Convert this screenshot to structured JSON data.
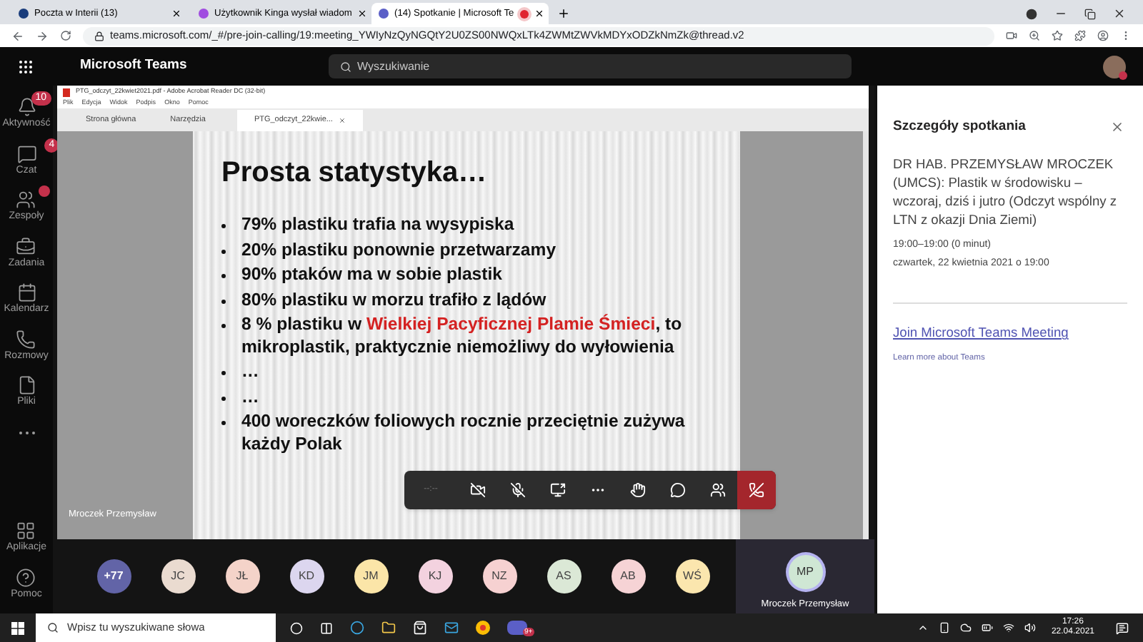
{
  "browser": {
    "tabs": [
      {
        "title": "Poczta w Interii (13)",
        "selected": false,
        "recording": false
      },
      {
        "title": "Użytkownik Kinga wysłał wiadom",
        "selected": false,
        "recording": false
      },
      {
        "title": "(14) Spotkanie | Microsoft Te",
        "selected": true,
        "recording": true
      }
    ],
    "url": "teams.microsoft.com/_#/pre-join-calling/19:meeting_YWIyNzQyNGQtY2U0ZS00NWQxLTk4ZWMtZWVkMDYxODZkNmZk@thread.v2"
  },
  "app": {
    "title": "Microsoft Teams",
    "search": {
      "placeholder": "Wyszukiwanie"
    }
  },
  "rail": [
    {
      "kind": "activity",
      "label": "Aktywność",
      "badge": "10",
      "dot": false
    },
    {
      "kind": "chat",
      "label": "Czat",
      "badge": "4",
      "dot": false
    },
    {
      "kind": "teams",
      "label": "Zespoły",
      "dot": true
    },
    {
      "kind": "tasks",
      "label": "Zadania",
      "dot": false
    },
    {
      "kind": "calendar",
      "label": "Kalendarz",
      "dot": false
    },
    {
      "kind": "calls",
      "label": "Rozmowy",
      "dot": false
    },
    {
      "kind": "files",
      "label": "Pliki",
      "dot": false
    },
    {
      "kind": "more",
      "dot": false
    },
    {
      "kind": "apps",
      "label": "Aplikacje",
      "dot": false
    },
    {
      "kind": "help",
      "label": "Pomoc",
      "dot": false
    }
  ],
  "shared_screen": {
    "window_title": "PTG_odczyt_22kwiet2021.pdf - Adobe Acrobat Reader DC (32-bit)",
    "menu": [
      "Plik",
      "Edycja",
      "Widok",
      "Podpis",
      "Okno",
      "Pomoc"
    ],
    "tabs": [
      {
        "label": "Strona główna",
        "selected": false
      },
      {
        "label": "Narzędzia",
        "selected": false
      },
      {
        "label": "PTG_odczyt_22kwie...",
        "selected": true
      }
    ],
    "presenter_name": "Mroczek Przemysław",
    "slide": {
      "title": "Prosta statystyka…",
      "bullets": [
        {
          "text": "79% plastiku trafia na wysypiska"
        },
        {
          "text": "20% plastiku ponownie przetwarzamy"
        },
        {
          "text": "90% ptaków ma w sobie plastik"
        },
        {
          "text": "80% plastiku w morzu trafiło z lądów"
        },
        {
          "text": "8 % plastiku w ",
          "highlight": "Wielkiej Pacyficznej Plamie Śmieci",
          "text_after": ", to mikroplastik, praktycznie niemożliwy do wyłowienia"
        },
        {
          "text": "…"
        },
        {
          "text": "…"
        },
        {
          "text": "400 woreczków foliowych rocznie przeciętnie zużywa każdy Polak"
        }
      ]
    }
  },
  "call_controls": {
    "timer": "--:--",
    "camera_on": false,
    "mic_on": false
  },
  "participants": [
    {
      "initials": "+77",
      "color": "#6264a7"
    },
    {
      "initials": "JC",
      "color": "#eadbd0"
    },
    {
      "initials": "JŁ",
      "color": "#f4d3c9"
    },
    {
      "initials": "KD",
      "color": "#dcd6ef"
    },
    {
      "initials": "JM",
      "color": "#fbe5a8"
    },
    {
      "initials": "KJ",
      "color": "#f3d2df"
    },
    {
      "initials": "NZ",
      "color": "#f6d1d1"
    },
    {
      "initials": "AS",
      "color": "#dbe8d6"
    },
    {
      "initials": "AB",
      "color": "#f6d3d5"
    },
    {
      "initials": "WŚ",
      "color": "#fbe6ae"
    }
  ],
  "speaker": {
    "initials": "MP",
    "name": "Mroczek Przemysław",
    "color": "#cfe7d4"
  },
  "details": {
    "title": "Szczegóły spotkania",
    "subject": "DR HAB. PRZEMYSŁAW MROCZEK (UMCS): Plastik w środowisku – wczoraj, dziś i jutro (Odczyt wspólny z LTN z okazji Dnia Ziemi)",
    "time": "19:00–19:00 (0 minut)",
    "date": "czwartek, 22 kwietnia 2021 o 19:00",
    "join_link": "Join Microsoft Teams Meeting",
    "learn_more": "Learn more about Teams"
  },
  "taskbar": {
    "search": {
      "placeholder": "Wpisz tu wyszukiwane słowa"
    },
    "teams_badge": "9+",
    "time": "17:26",
    "date": "22.04.2021"
  }
}
